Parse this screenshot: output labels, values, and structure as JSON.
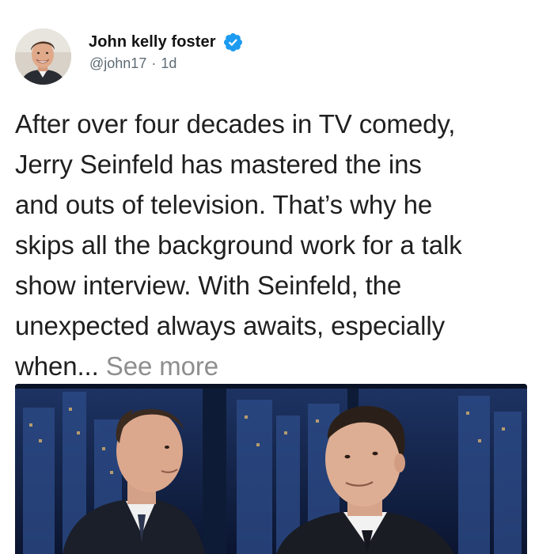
{
  "tweet": {
    "author": {
      "display_name": "John kelly foster",
      "handle": "@john17",
      "verified": true,
      "avatar_icon": "profile-photo"
    },
    "time_separator": "·",
    "relative_time": "1d",
    "text": "After over four decades in TV comedy,\nJerry Seinfeld has mastered the ins\nand outs of television. That’s why he\nskips all the background work for a talk\nshow interview. With Seinfeld, the\nunexpected always awaits, especially\nwhen...",
    "see_more_label": "See more",
    "media": {
      "type": "photo",
      "description_icon": "talk-show-photo"
    }
  },
  "colors": {
    "verified_blue": "#1d9bf0",
    "secondary_text": "#5e6b75",
    "see_more": "#8e8e8e",
    "body_text": "#1f1f1f"
  }
}
